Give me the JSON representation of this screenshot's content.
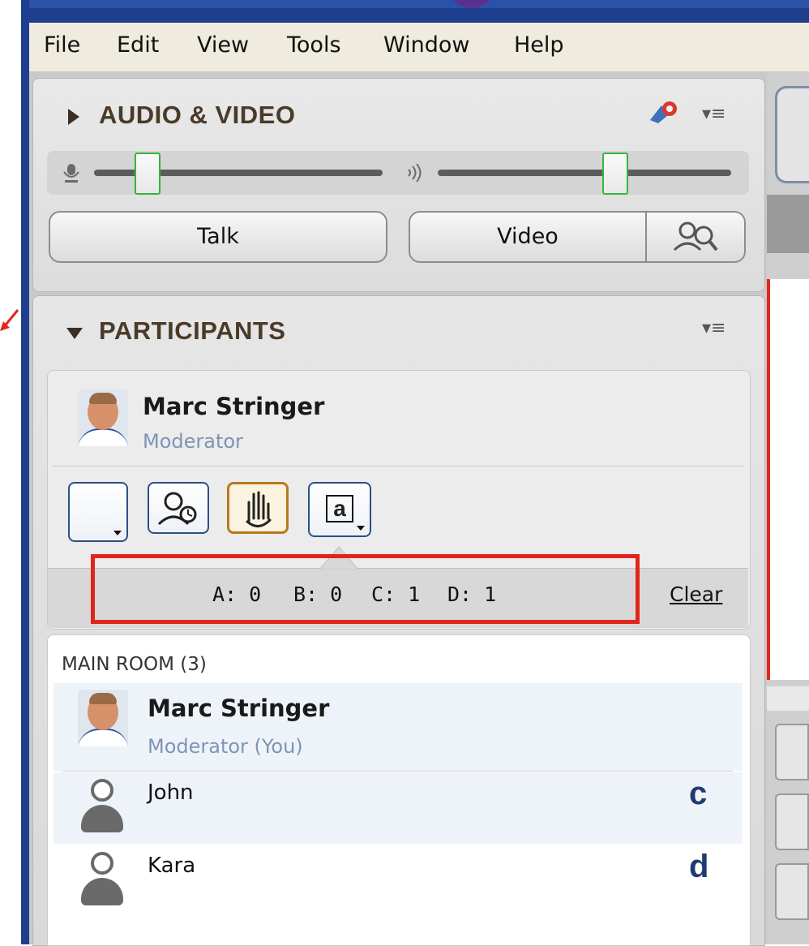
{
  "menu": {
    "items": [
      {
        "label": "File"
      },
      {
        "label": "Edit"
      },
      {
        "label": "View"
      },
      {
        "label": "Tools"
      },
      {
        "label": "Window"
      },
      {
        "label": "Help"
      }
    ]
  },
  "audio_video": {
    "title": "AUDIO & VIDEO",
    "mic_level": 0.18,
    "speaker_level": 0.6,
    "talk_label": "Talk",
    "video_label": "Video"
  },
  "participants": {
    "title": "PARTICIPANTS",
    "me": {
      "name": "Marc Stringer",
      "role": "Moderator"
    },
    "poll": {
      "a": "A: 0",
      "b": "B: 0",
      "c": "C: 1",
      "d": "D: 1",
      "clear_label": "Clear"
    },
    "room_label": "MAIN ROOM (3)",
    "list": [
      {
        "name": "Marc Stringer",
        "role": "Moderator (You)",
        "answer": ""
      },
      {
        "name": "John",
        "role": "",
        "answer": "c"
      },
      {
        "name": "Kara",
        "role": "",
        "answer": "d"
      }
    ]
  },
  "colors": {
    "highlight_box": "#e0261b",
    "slider_thumb_border": "#39b33f",
    "section_title": "#4a3b29"
  },
  "icons": [
    "microphone-icon",
    "speaker-icon",
    "settings-gear-icon",
    "panel-menu-icon",
    "camera-preferences-icon",
    "status-away-icon",
    "raise-hand-icon",
    "answer-a-icon",
    "person-icon"
  ]
}
